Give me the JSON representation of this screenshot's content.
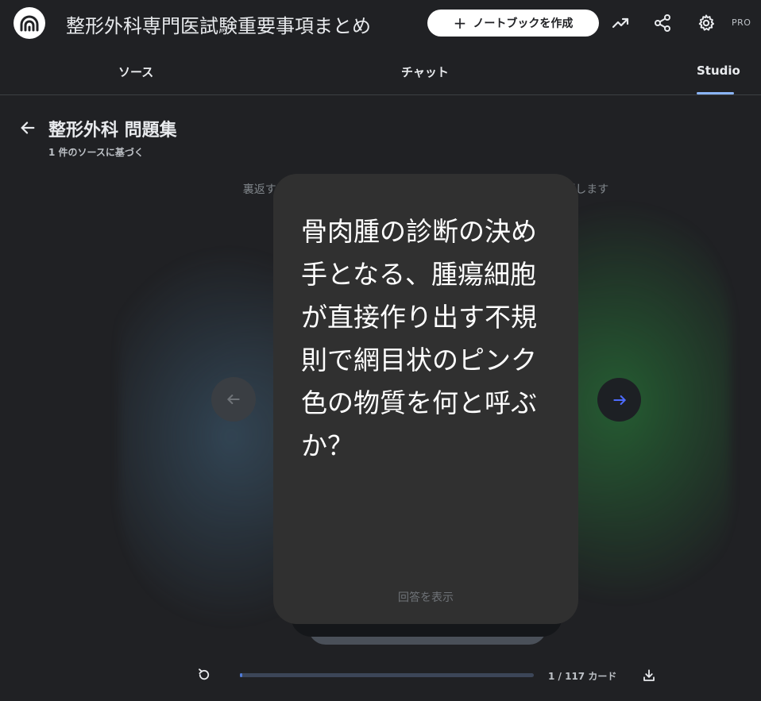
{
  "header": {
    "app_title": "整形外科専門医試験重要事項まとめ",
    "create_button_label": "ノートブックを作成",
    "badge": "PRO"
  },
  "icons": {
    "logo": "notebooklm-logo-icon",
    "analytics": "trending-up-icon",
    "share": "share-icon",
    "settings": "gear-icon",
    "back": "arrow-left-icon",
    "prev": "arrow-left-icon",
    "next": "arrow-right-icon",
    "restart": "refresh-icon",
    "download": "download-icon"
  },
  "tabs": [
    {
      "label": "ソース",
      "active": false
    },
    {
      "label": "チャット",
      "active": false
    },
    {
      "label": "Studio",
      "active": true
    }
  ],
  "page": {
    "title": "整形外科 問題集",
    "subtitle": "1 件のソースに基づく",
    "hint": "裏返すには                                                                        を押します"
  },
  "card": {
    "question": "骨肉腫の診断の決め手となる、腫瘍細胞が直接作り出す不規則で網目状のピンク色の物質を何と呼ぶか？",
    "reveal_label": "回答を表示"
  },
  "progress": {
    "current": 1,
    "total": 117,
    "counter_text": "1 / 117 カード"
  },
  "colors": {
    "background": "#202124",
    "card": "#303030",
    "accent": "#8ab4f8",
    "next_arrow": "#4d6bfe"
  }
}
